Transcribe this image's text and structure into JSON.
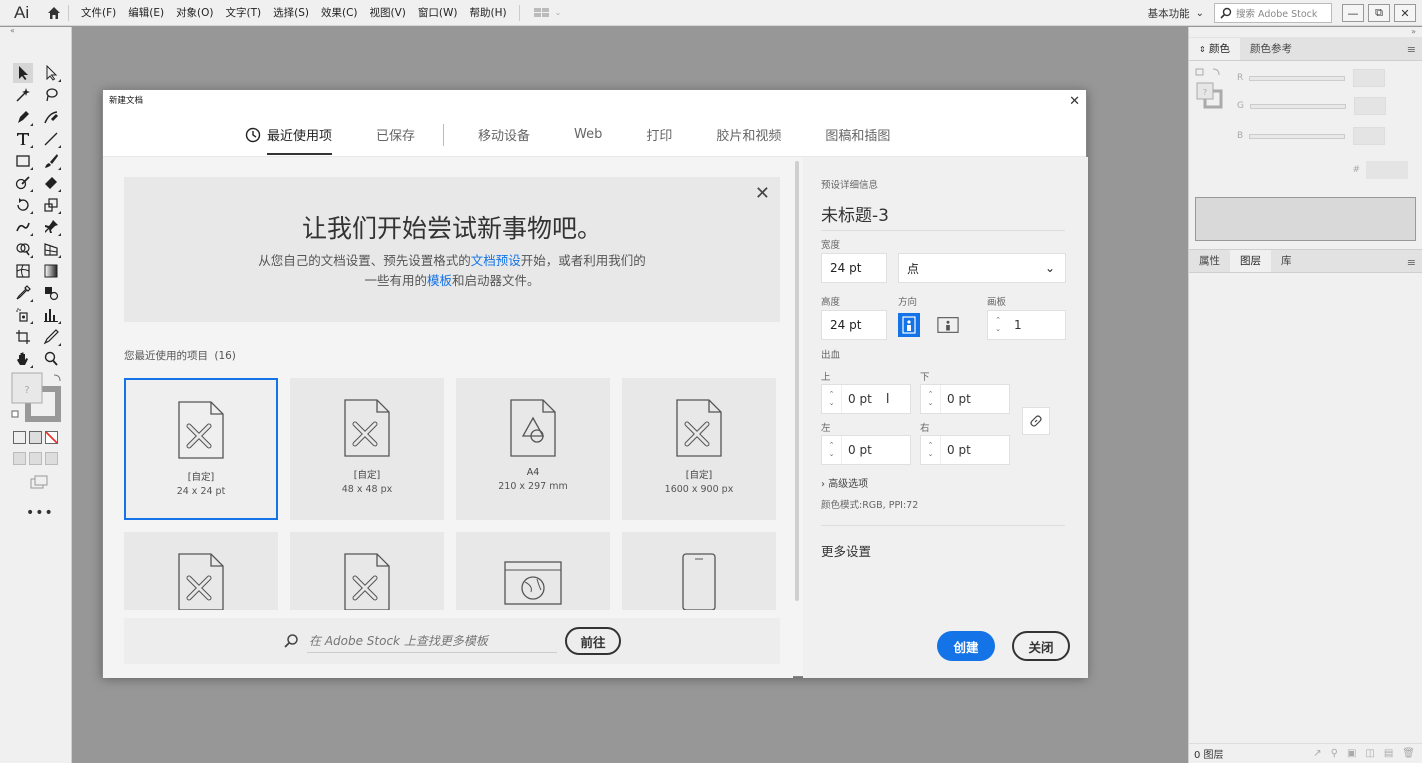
{
  "app": {
    "logo": "Ai",
    "menu": [
      "文件(F)",
      "编辑(E)",
      "对象(O)",
      "文字(T)",
      "选择(S)",
      "效果(C)",
      "视图(V)",
      "窗口(W)",
      "帮助(H)"
    ],
    "workspace": "基本功能",
    "stock_search_placeholder": "搜索 Adobe Stock"
  },
  "right_panel": {
    "top_tabs": [
      "颜色",
      "颜色参考"
    ],
    "channels": [
      "R",
      "G",
      "B"
    ],
    "hex_label": "#",
    "bottom_tabs": [
      "属性",
      "图层",
      "库"
    ],
    "layers_count": "0 图层"
  },
  "dialog": {
    "title": "新建文档",
    "tabs": [
      "最近使用项",
      "已保存",
      "移动设备",
      "Web",
      "打印",
      "胶片和视频",
      "图稿和插图"
    ],
    "hero": {
      "heading": "让我们开始尝试新事物吧。",
      "line1_a": "从您自己的文档设置、预先设置格式的",
      "line1_link": "文档预设",
      "line1_b": "开始，或者利用我们的",
      "line2_a": "一些有用的",
      "line2_link": "模板",
      "line2_b": "和启动器文件。"
    },
    "recent_title": "您最近使用的项目",
    "recent_count": "(16)",
    "cards": [
      {
        "name": "[自定]",
        "size": "24 x 24 pt",
        "icon": "custom-doc-icon"
      },
      {
        "name": "[自定]",
        "size": "48 x 48 px",
        "icon": "custom-doc-icon"
      },
      {
        "name": "A4",
        "size": "210 x 297 mm",
        "icon": "print-doc-icon"
      },
      {
        "name": "[自定]",
        "size": "1600 x 900 px",
        "icon": "custom-doc-icon"
      }
    ],
    "stock_placeholder": "在 Adobe Stock 上查找更多模板",
    "go_label": "前往",
    "details": {
      "section": "预设详细信息",
      "doc_name": "未标题-3",
      "width_label": "宽度",
      "width": "24 pt",
      "unit": "点",
      "height_label": "高度",
      "height": "24 pt",
      "orientation_label": "方向",
      "artboards_label": "画板",
      "artboards": "1",
      "bleed_label": "出血",
      "top_label": "上",
      "top": "0 pt",
      "bottom_label": "下",
      "bottom": "0 pt",
      "left_label": "左",
      "left": "0 pt",
      "right_label": "右",
      "right": "0 pt",
      "advanced": "高级选项",
      "color_mode": "颜色模式:RGB, PPI:72",
      "more_settings": "更多设置",
      "create_label": "创建",
      "close_label": "关闭"
    }
  }
}
